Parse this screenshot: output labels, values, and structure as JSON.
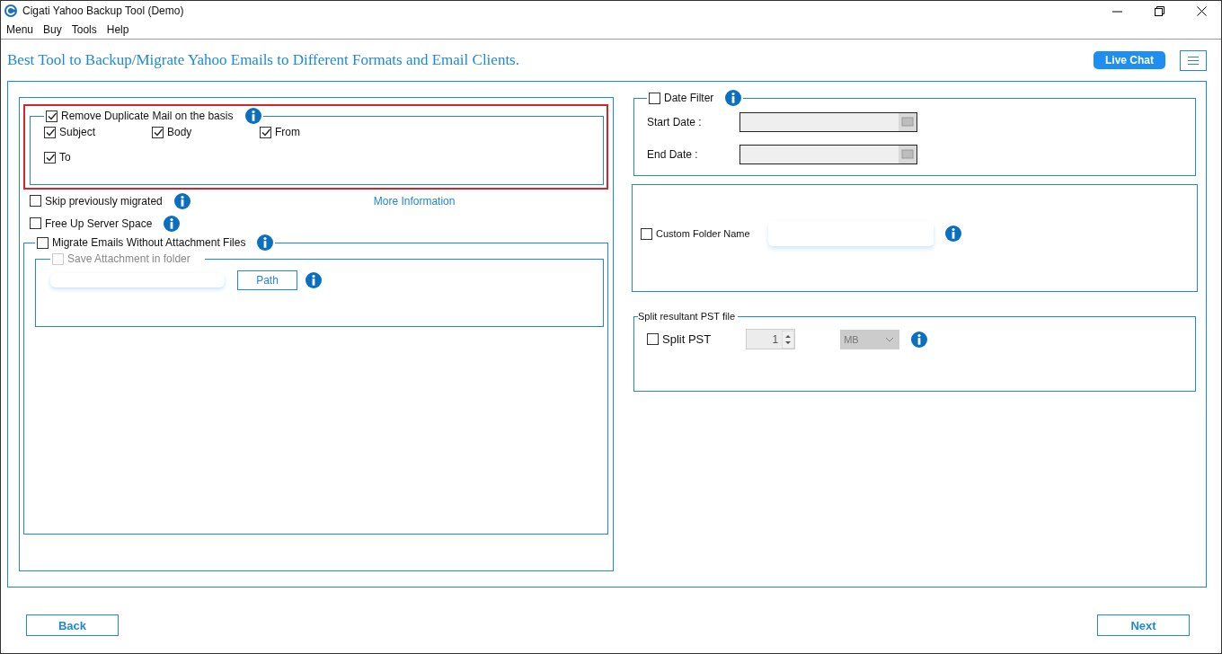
{
  "window": {
    "title": "Cigati Yahoo Backup Tool (Demo)"
  },
  "menu": [
    "Menu",
    "Buy",
    "Tools",
    "Help"
  ],
  "header": {
    "tagline": "Best Tool to Backup/Migrate Yahoo Emails to Different Formats and Email Clients.",
    "live_chat": "Live Chat"
  },
  "duplicates": {
    "label": "Remove Duplicate Mail on the basis",
    "checked": true,
    "options": [
      {
        "label": "Subject",
        "checked": true
      },
      {
        "label": "Body",
        "checked": true
      },
      {
        "label": "From",
        "checked": true
      },
      {
        "label": "To",
        "checked": true
      }
    ]
  },
  "skip_previously_migrated": {
    "label": "Skip previously migrated",
    "checked": false
  },
  "more_information": "More Information",
  "free_up_server_space": {
    "label": "Free Up Server Space",
    "checked": false
  },
  "without_attachments": {
    "label": "Migrate Emails Without Attachment Files",
    "checked": false
  },
  "save_attachment": {
    "label": "Save Attachment in folder",
    "checked": false,
    "disabled": true,
    "path_button": "Path"
  },
  "date_filter": {
    "label": "Date Filter",
    "checked": false,
    "start_label": "Start Date :",
    "end_label": "End Date :"
  },
  "custom_folder": {
    "label": "Custom Folder Name",
    "checked": false
  },
  "split": {
    "title": "Split resultant PST file",
    "label": "Split PST",
    "checked": false,
    "value": "1",
    "unit": "MB"
  },
  "buttons": {
    "back": "Back",
    "next": "Next"
  }
}
